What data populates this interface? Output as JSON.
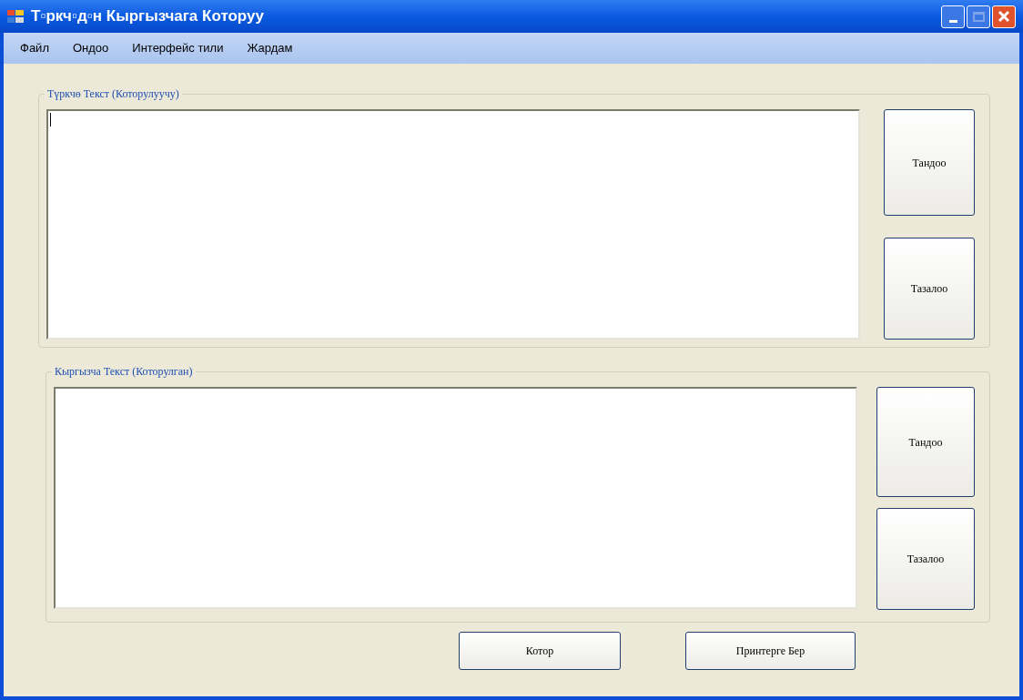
{
  "window": {
    "title": "Т▫ркч▫д▫н Кыргызчага Которуу"
  },
  "menu": [
    "Файл",
    "Ондоо",
    "Интерфейс тили",
    "Жардам"
  ],
  "groups": [
    {
      "label": "Түркчө Текст (Которулуучу)",
      "focused": true,
      "buttons": [
        "Тандоо",
        "Тазалоо"
      ]
    },
    {
      "label": "Кыргызча Текст (Которулган)",
      "focused": false,
      "buttons": [
        "Тандоо",
        "Тазалоо"
      ]
    }
  ],
  "buttons": [
    "Котор",
    "Принтерге Бер"
  ]
}
